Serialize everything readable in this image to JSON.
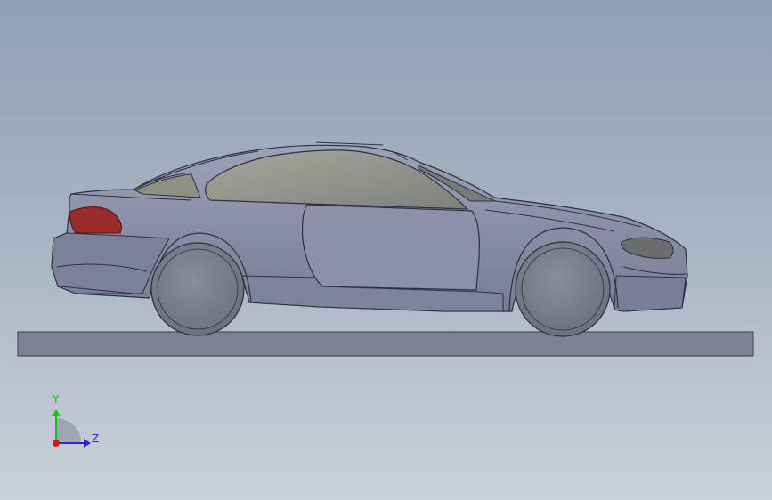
{
  "triad": {
    "y_label": "Y",
    "z_label": "Z"
  },
  "colors": {
    "background_top": "#8fa0b3",
    "background_bottom": "#c9d0d9",
    "body": "#8a8ea5",
    "body_dark": "#747891",
    "glass": "#8c8e88",
    "tail_light": "#9a2b2b",
    "tire": "#7b7e8c",
    "ground_plane": "#7e8193",
    "axis_x": "#cc1a1a",
    "axis_y": "#18c018",
    "axis_z": "#2a2acf"
  }
}
